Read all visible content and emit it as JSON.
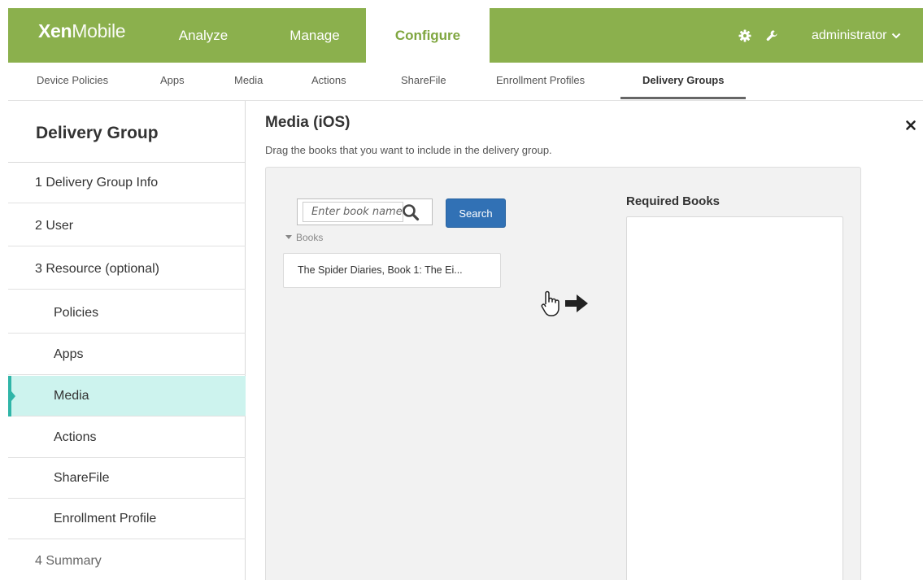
{
  "app": {
    "logo_bold": "Xen",
    "logo_light": "Mobile"
  },
  "topnav": {
    "items": [
      {
        "label": "Analyze"
      },
      {
        "label": "Manage"
      },
      {
        "label": "Configure"
      }
    ],
    "active": "Configure",
    "user": "administrator",
    "icons": [
      "gear-icon",
      "wrench-icon",
      "chevron-down-icon"
    ],
    "bar_color": "#8bb04d",
    "active_color": "#7fa63f"
  },
  "subnav": {
    "items": [
      {
        "label": "Device Policies"
      },
      {
        "label": "Apps"
      },
      {
        "label": "Media"
      },
      {
        "label": "Actions"
      },
      {
        "label": "ShareFile"
      },
      {
        "label": "Enrollment Profiles"
      },
      {
        "label": "Delivery Groups"
      }
    ],
    "active": "Delivery Groups"
  },
  "sidebar": {
    "title": "Delivery Group",
    "steps": [
      {
        "label": "1  Delivery Group Info"
      },
      {
        "label": "2  User"
      },
      {
        "label": "3  Resource (optional)"
      },
      {
        "label": "Policies"
      },
      {
        "label": "Apps"
      },
      {
        "label": "Media"
      },
      {
        "label": "Actions"
      },
      {
        "label": "ShareFile"
      },
      {
        "label": "Enrollment Profile"
      },
      {
        "label": "4  Summary"
      }
    ],
    "active": "Media",
    "active_color": "#cdf3ee",
    "accent_color": "#30b5a8"
  },
  "main": {
    "title": "Media (iOS)",
    "description": "Drag the books that you want to include in the delivery group.",
    "search": {
      "placeholder": "Enter book name",
      "value": "",
      "button_label": "Search"
    },
    "books": {
      "toggle_label": "Books",
      "items": [
        {
          "title": "The Spider Diaries, Book 1: The Ei..."
        }
      ]
    },
    "required": {
      "label": "Required Books",
      "items": []
    },
    "button_color": "#3171b5"
  }
}
